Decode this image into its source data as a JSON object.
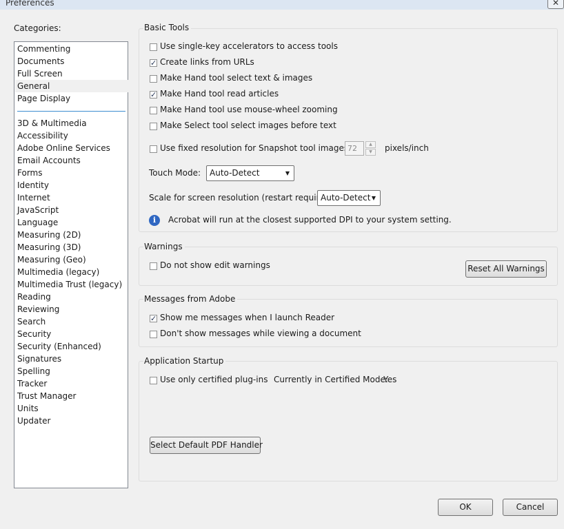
{
  "window": {
    "title": "Preferences",
    "close_glyph": "✕"
  },
  "categories": {
    "label": "Categories:",
    "top_items": [
      "Commenting",
      "Documents",
      "Full Screen",
      "General",
      "Page Display"
    ],
    "bottom_items": [
      "3D & Multimedia",
      "Accessibility",
      "Adobe Online Services",
      "Email Accounts",
      "Forms",
      "Identity",
      "Internet",
      "JavaScript",
      "Language",
      "Measuring (2D)",
      "Measuring (3D)",
      "Measuring (Geo)",
      "Multimedia (legacy)",
      "Multimedia Trust (legacy)",
      "Reading",
      "Reviewing",
      "Search",
      "Security",
      "Security (Enhanced)",
      "Signatures",
      "Spelling",
      "Tracker",
      "Trust Manager",
      "Units",
      "Updater"
    ],
    "selected": "General"
  },
  "basic_tools": {
    "title": "Basic Tools",
    "options": [
      {
        "label": "Use single-key accelerators to access tools",
        "checked": false
      },
      {
        "label": "Create links from URLs",
        "checked": true
      },
      {
        "label": "Make Hand tool select text & images",
        "checked": false
      },
      {
        "label": "Make Hand tool read articles",
        "checked": true
      },
      {
        "label": "Make Hand tool use mouse-wheel zooming",
        "checked": false
      },
      {
        "label": "Make Select tool select images before text",
        "checked": false
      }
    ],
    "snapshot": {
      "label": "Use fixed resolution for Snapshot tool images:",
      "checked": false,
      "value": "72",
      "unit": "pixels/inch"
    },
    "touch_mode": {
      "label": "Touch Mode:",
      "value": "Auto-Detect"
    },
    "scale": {
      "label": "Scale for screen resolution (restart required):",
      "value": "Auto-Detect"
    },
    "info_text": "Acrobat will run at the closest supported DPI to your system setting."
  },
  "warnings": {
    "title": "Warnings",
    "option": {
      "label": "Do not show edit warnings",
      "checked": false
    },
    "reset_button": "Reset All Warnings"
  },
  "messages": {
    "title": "Messages from Adobe",
    "options": [
      {
        "label": "Show me messages when I launch Reader",
        "checked": true
      },
      {
        "label": "Don't show messages while viewing a document",
        "checked": false
      }
    ]
  },
  "startup": {
    "title": "Application Startup",
    "option": {
      "label": "Use only certified plug-ins",
      "checked": false
    },
    "certified_label": "Currently in Certified Mode:",
    "certified_value": "Yes",
    "pdf_handler_button": "Select Default PDF Handler"
  },
  "footer": {
    "ok": "OK",
    "cancel": "Cancel"
  },
  "icons": {
    "check": "✓",
    "arrow_down": "▼",
    "arrow_up": "▲",
    "info": "i"
  },
  "colors": {
    "selection_separator": "#3c8cd0",
    "info_icon": "#2f67c2"
  }
}
